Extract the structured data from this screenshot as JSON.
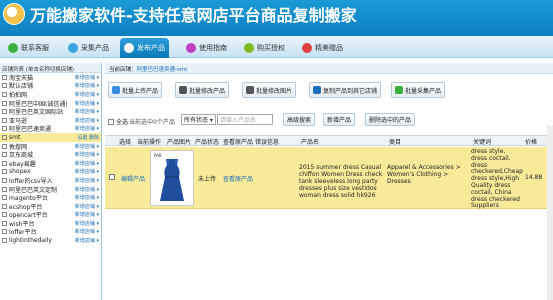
{
  "header": {
    "title": "万能搬家软件-支持任意网店平台商品复制搬家",
    "bg_color": "#1489ca"
  },
  "nav": {
    "tabs": [
      {
        "label": "联系客服",
        "icon": "contact-icon",
        "color": "#3cb03c"
      },
      {
        "label": "采集产品",
        "icon": "collect-icon",
        "color": "#3aa3e0"
      },
      {
        "label": "发布产品",
        "icon": "publish-icon",
        "color": "#1d8fd0",
        "active": true
      },
      {
        "label": "使用指南",
        "icon": "guide-icon",
        "color": "#c040c0"
      },
      {
        "label": "购买授权",
        "icon": "buy-icon",
        "color": "#7fba1e"
      },
      {
        "label": "精美赠品",
        "icon": "gift-icon",
        "color": "#e04040"
      }
    ]
  },
  "sidebar": {
    "header": "店铺列表 (单击名称切换店铺)",
    "stores": [
      {
        "name": "淘宝天猫",
        "acts": "新增店铺 ▾"
      },
      {
        "name": "默认店铺",
        "acts": "新增店铺 ▾"
      },
      {
        "name": "拍拍网",
        "acts": "新增店铺 ▾"
      },
      {
        "name": "阿里巴巴中国(诚信通)",
        "acts": "新增店铺 ▾"
      },
      {
        "name": "阿里巴巴英文国际站",
        "acts": "新增店铺 ▾"
      },
      {
        "name": "亚马逊",
        "acts": "新增店铺 ▾"
      },
      {
        "name": "阿里巴巴速卖通",
        "acts": "新增店铺 ▾"
      },
      {
        "name": "smt",
        "acts": "设置  删除",
        "selected": true
      },
      {
        "name": "敦煌网",
        "acts": "新增店铺 ▾"
      },
      {
        "name": "京东商城",
        "acts": "新增店铺 ▾"
      },
      {
        "name": "ebay易趣",
        "acts": "新增店铺 ▾"
      },
      {
        "name": "shopex",
        "acts": "新增店铺 ▾"
      },
      {
        "name": "loffer的csv导入",
        "acts": "新增店铺 ▾"
      },
      {
        "name": "阿里巴巴英文定制",
        "acts": "新增店铺 ▾"
      },
      {
        "name": "magento平台",
        "acts": "新增店铺 ▾"
      },
      {
        "name": "ecshop平台",
        "acts": "新增店铺 ▾"
      },
      {
        "name": "opencart平台",
        "acts": "新增店铺 ▾"
      },
      {
        "name": "wish平台",
        "acts": "新增店铺 ▾"
      },
      {
        "name": "loffer平台",
        "acts": "新增店铺 ▾"
      },
      {
        "name": "lightinthedaily",
        "acts": "新增店铺 ▾"
      }
    ]
  },
  "breadcrumb": {
    "prefix": "当前店铺：",
    "path": "阿里巴巴速卖通-smt"
  },
  "toolbar": {
    "btn1": "批量上传产品",
    "btn2": "批量修改产品",
    "btn3": "批量修改图片",
    "btn4": "复制产品到其它店铺",
    "btn5": "批量采集产品"
  },
  "filter": {
    "select_all": "全选",
    "selected_count": "当前选中0个产品",
    "status_select": "所有状态 ▾",
    "search_placeholder": "请输入产品名",
    "adv_search": "高级搜索",
    "new_product": "新增产品",
    "delete_selected": "删除选中的产品"
  },
  "table": {
    "headers": [
      "选择",
      "当前操作",
      "产品图片",
      "产品状态",
      "查看原产品",
      "错误信息",
      "产品名",
      "类目",
      "关键词",
      "价格"
    ],
    "rows": [
      {
        "op": "编辑产品",
        "status": "未上传",
        "view": "查看原产品",
        "name": "2015 summer dress Casual chiffon Women Dress check tank sleeveless long party dresses plus size vestidos woman dress solid hk926",
        "category": "Apparel & Accessories > Women's Clothing > Dresses",
        "keywords": "dress style, dress coctail, dress checkered,Cheap dress style,High Quality dress coctail, China dress checkered Suppliers",
        "price": "14.88"
      }
    ]
  }
}
